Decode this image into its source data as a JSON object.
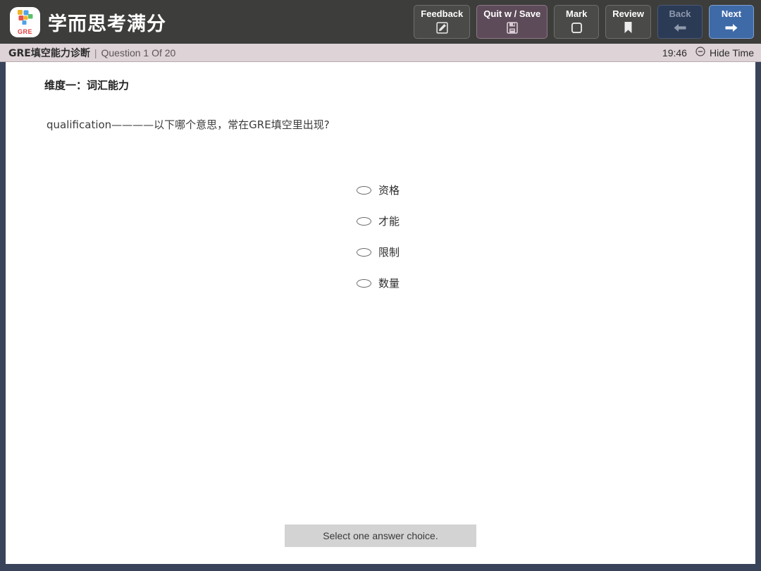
{
  "header": {
    "brand_title": "学而思考满分",
    "logo_text": "GRE",
    "buttons": [
      {
        "label": "Feedback",
        "icon": "compose-icon"
      },
      {
        "label": "Quit w / Save",
        "icon": "save-floppy-icon"
      },
      {
        "label": "Mark",
        "icon": "square-outline-icon"
      },
      {
        "label": "Review",
        "icon": "bookmark-icon"
      },
      {
        "label": "Back",
        "icon": "arrow-left-icon"
      },
      {
        "label": "Next",
        "icon": "arrow-right-icon"
      }
    ]
  },
  "statusbar": {
    "section": "GRE填空能力诊断",
    "divider": "|",
    "question_counter": "Question 1 Of 20",
    "time": "19:46",
    "hide_time_label": "Hide Time",
    "hide_time_icon": "circle-minus-icon"
  },
  "question": {
    "dimension_heading": "维度一：词汇能力",
    "stem": "qualification————以下哪个意思，常在GRE填空里出现?",
    "choices": [
      {
        "label": "资格"
      },
      {
        "label": "才能"
      },
      {
        "label": "限制"
      },
      {
        "label": "数量"
      }
    ]
  },
  "footer": {
    "instruction": "Select one answer choice."
  },
  "colors": {
    "frame": "#39435a",
    "toolbar": "#3d3d3b",
    "statusbar": "#ded3d6",
    "quit_button": "#5e4b59",
    "next_button": "#3f6aa8",
    "back_button": "#2b3a55",
    "instruction_bar": "#d3d3d3"
  }
}
